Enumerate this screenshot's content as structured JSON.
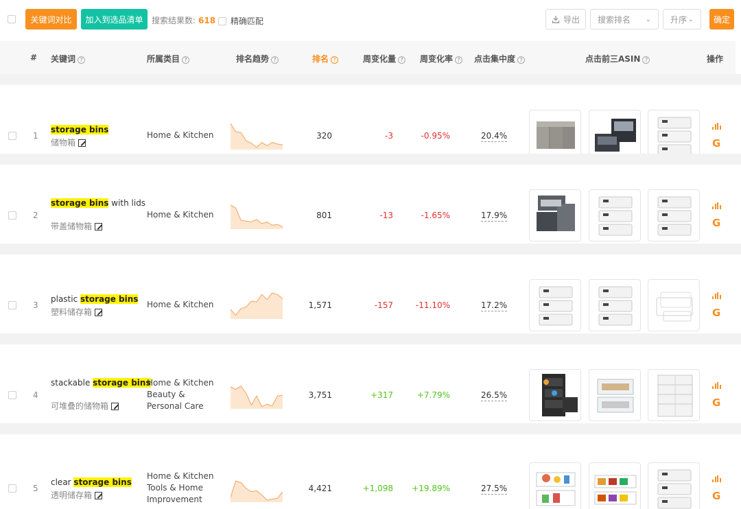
{
  "toolbar": {
    "compare_label": "关键词对比",
    "add_list_label": "加入到选品清单",
    "results_label": "搜索结果数:",
    "results_count": "618",
    "exact_label": "精确匹配",
    "export_label": "导出",
    "sort_field_placeholder": "搜索排名",
    "sort_order": "升序",
    "confirm_label": "确定"
  },
  "header": {
    "index": "#",
    "keyword": "关键词",
    "category": "所属类目",
    "trend": "排名趋势",
    "rank": "排名",
    "weekly_change": "周变化量",
    "weekly_rate": "周变化率",
    "click_concentration": "点击集中度",
    "top3_asin": "点击前三ASIN",
    "actions": "操作"
  },
  "colors": {
    "accent": "#f7901e",
    "teal": "#13c2a2",
    "highlight": "#fff200",
    "down": "#e0312d",
    "up": "#52c41a"
  },
  "rows": [
    {
      "index": "1",
      "kw_pre": "",
      "kw_hl": "storage bins",
      "kw_post": "",
      "cn": "储物箱",
      "category": [
        "Home & Kitchen"
      ],
      "rank": "320",
      "change": "-3",
      "rate": "-0.95%",
      "dir": "down",
      "concentration": "20.4%",
      "trend": [
        60,
        40,
        38,
        18,
        12,
        2,
        14,
        6,
        14,
        10,
        8
      ]
    },
    {
      "index": "2",
      "kw_pre": "",
      "kw_hl": "storage bins",
      "kw_post": " with lids",
      "cn": "带盖储物箱",
      "category": [
        "Home & Kitchen"
      ],
      "rank": "801",
      "change": "-13",
      "rate": "-1.65%",
      "dir": "down",
      "concentration": "17.9%",
      "trend": [
        55,
        48,
        18,
        16,
        14,
        20,
        10,
        14,
        6,
        8,
        2
      ]
    },
    {
      "index": "3",
      "kw_pre": "plastic ",
      "kw_hl": "storage bins",
      "kw_post": "",
      "cn": "塑料储存箱",
      "category": [
        "Home & Kitchen"
      ],
      "rank": "1,571",
      "change": "-157",
      "rate": "-11.10%",
      "dir": "down",
      "concentration": "17.2%",
      "trend": [
        20,
        6,
        22,
        26,
        40,
        38,
        56,
        44,
        60,
        56,
        46
      ]
    },
    {
      "index": "4",
      "kw_pre": "stackable ",
      "kw_hl": "storage bins",
      "kw_post": "",
      "cn": "可堆叠的储物箱",
      "category": [
        "Home & Kitchen",
        "Beauty &",
        "Personal Care"
      ],
      "rank": "3,751",
      "change": "+317",
      "rate": "+7.79%",
      "dir": "up",
      "concentration": "26.5%",
      "trend": [
        50,
        44,
        52,
        34,
        6,
        28,
        2,
        8,
        4,
        28,
        30
      ]
    },
    {
      "index": "5",
      "kw_pre": "clear ",
      "kw_hl": "storage bins",
      "kw_post": "",
      "cn": "透明储存箱",
      "category": [
        "Home & Kitchen",
        "Tools & Home",
        "Improvement"
      ],
      "rank": "4,421",
      "change": "+1,098",
      "rate": "+19.89%",
      "dir": "up",
      "concentration": "27.5%",
      "trend": [
        8,
        48,
        44,
        30,
        22,
        24,
        14,
        2,
        4,
        6,
        22
      ]
    }
  ]
}
